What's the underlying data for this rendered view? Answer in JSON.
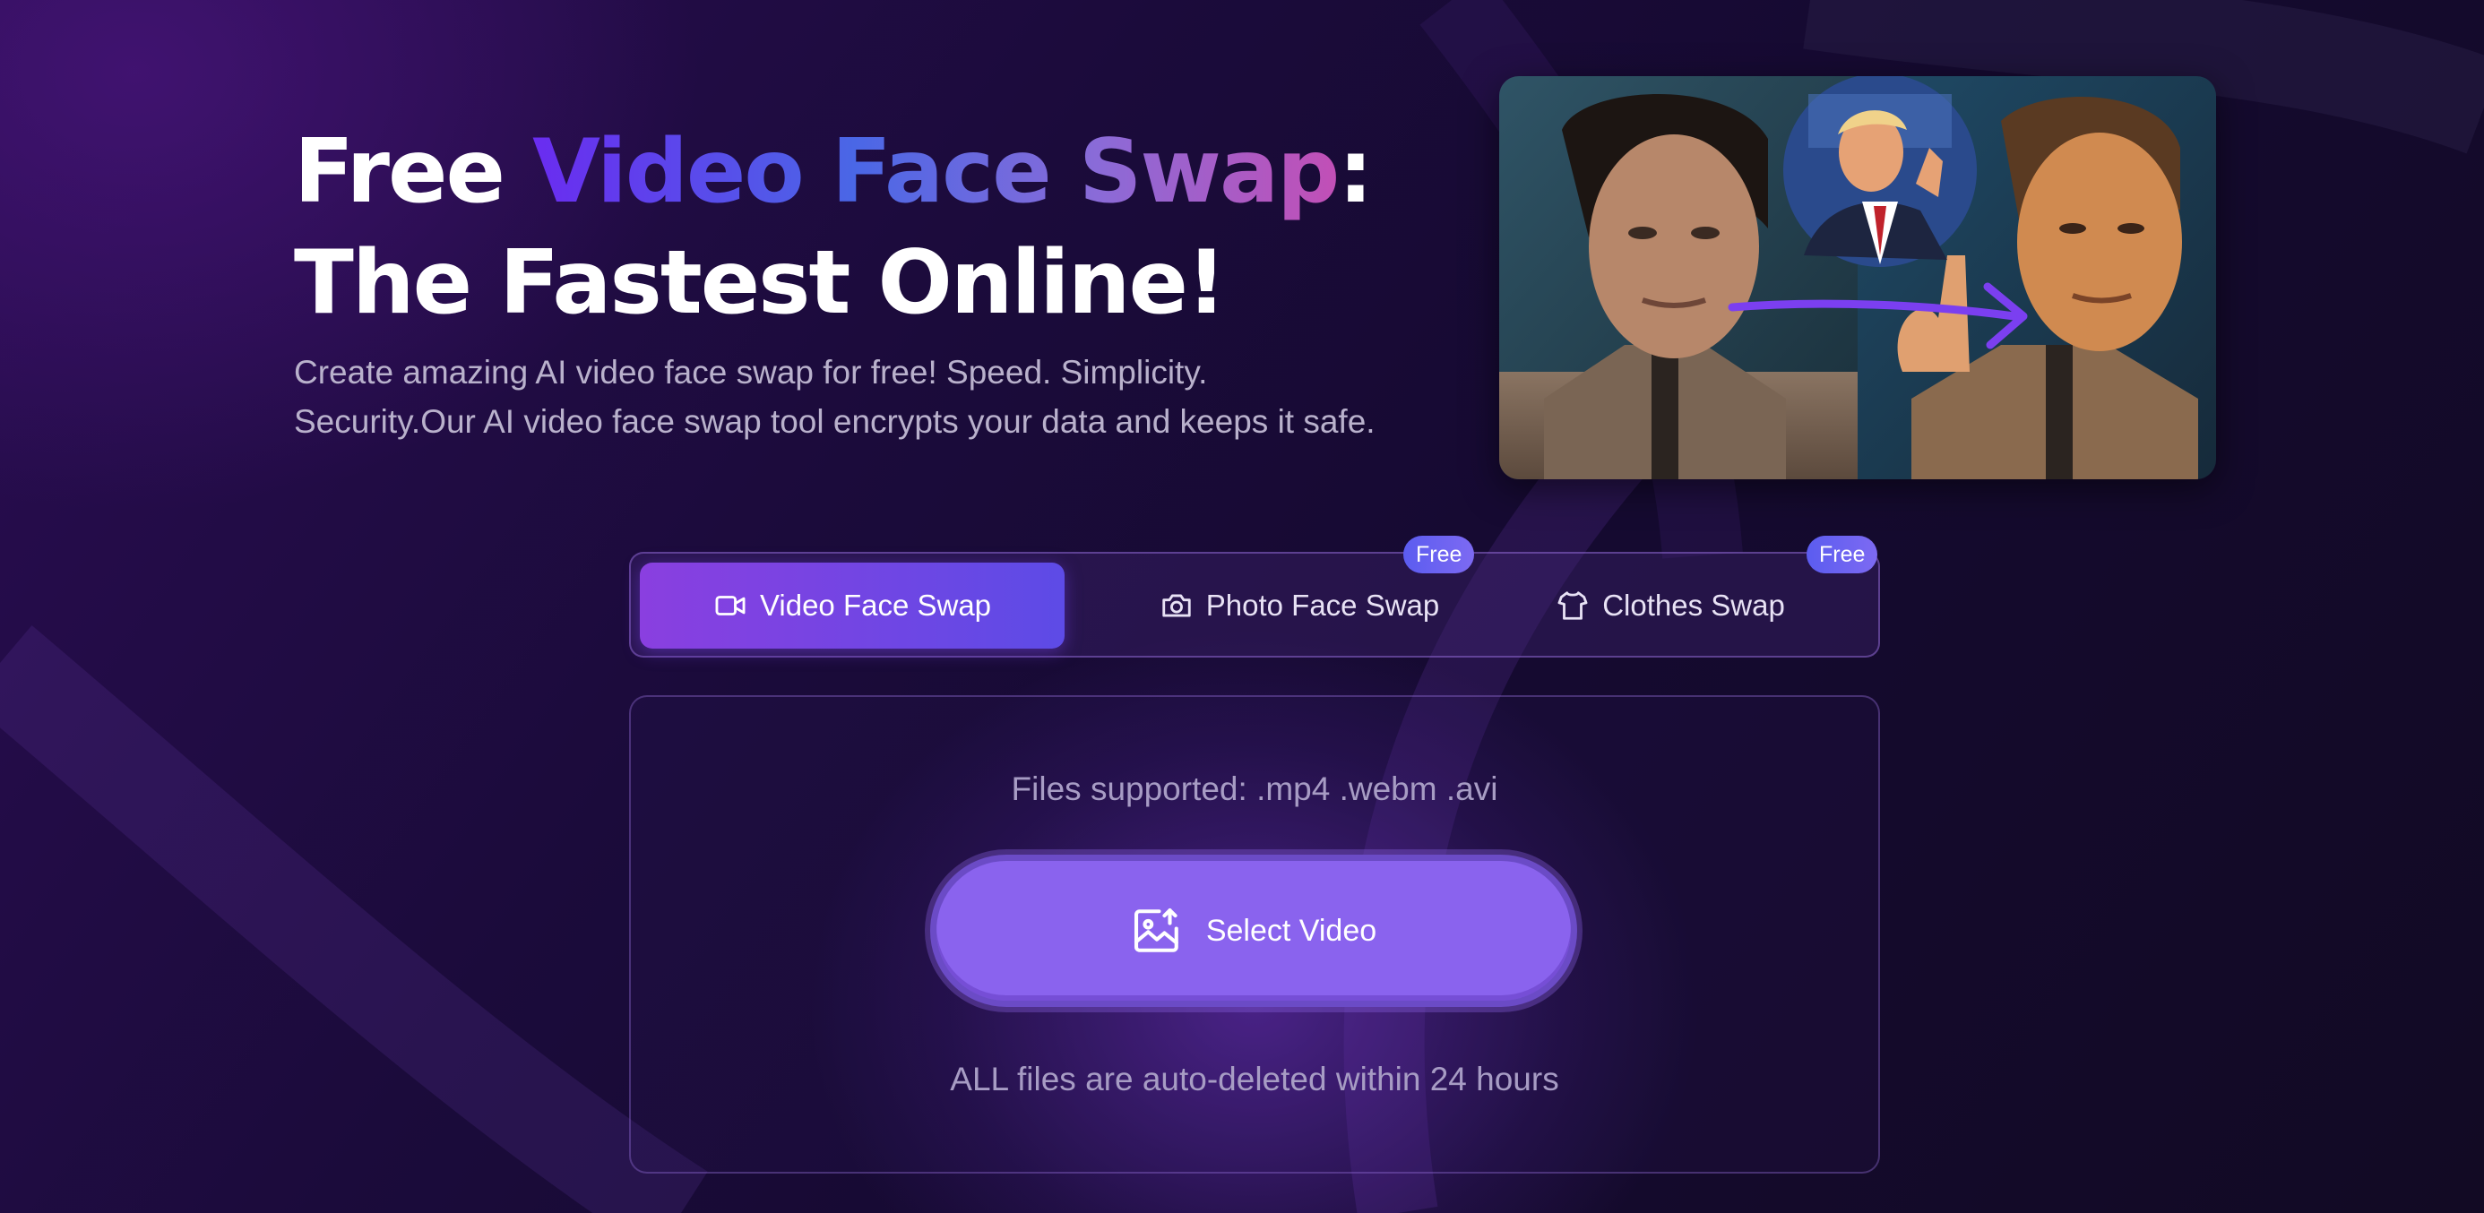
{
  "hero": {
    "title_prefix": "Free ",
    "title_highlight": "Video Face Swap",
    "title_colon": ":",
    "title_line2": "The Fastest Online!",
    "subtitle_line1": "Create amazing AI video face swap for free!  Speed. Simplicity.",
    "subtitle_line2": "Security.Our AI video face swap tool encrypts your data and keeps it safe."
  },
  "tabs": [
    {
      "label": "Video Face Swap",
      "icon": "video-camera-icon",
      "active": true,
      "badge": ""
    },
    {
      "label": "Photo Face Swap",
      "icon": "camera-icon",
      "active": false,
      "badge": "Free"
    },
    {
      "label": "Clothes Swap",
      "icon": "shirt-icon",
      "active": false,
      "badge": "Free"
    }
  ],
  "upload": {
    "files_supported": "Files supported: .mp4 .webm .avi",
    "button_label": "Select Video",
    "button_icon": "image-upload-icon",
    "note": "ALL files are auto-deleted within 24 hours"
  },
  "colors": {
    "accent": "#8a63ee",
    "tab_active_start": "#8a3fe0",
    "tab_active_end": "#5d4be6",
    "badge": "#5b5cf0"
  }
}
